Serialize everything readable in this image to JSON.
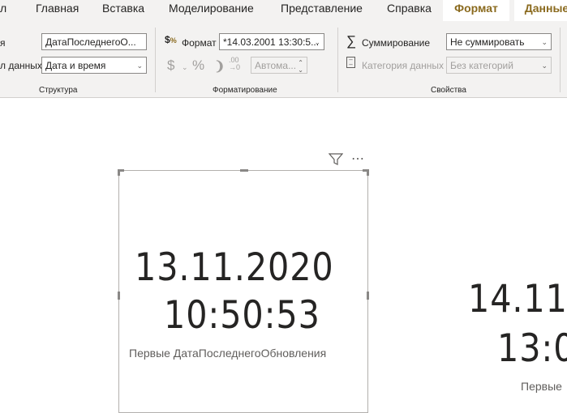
{
  "tabs": [
    {
      "label": "л"
    },
    {
      "label": "Главная"
    },
    {
      "label": "Вставка"
    },
    {
      "label": "Моделирование"
    },
    {
      "label": "Представление"
    },
    {
      "label": "Справка"
    },
    {
      "label": "Формат"
    },
    {
      "label": "Данные"
    }
  ],
  "structure": {
    "name_label": "я",
    "name_value": "ДатаПоследнегоО...",
    "type_label": "л данных",
    "type_value": "Дата и время",
    "group_label": "Структура"
  },
  "formatting": {
    "format_label": "Формат",
    "format_value": "*14.03.2001 13:30:5...",
    "currency_symbol": "$",
    "percent_symbol": "%",
    "comma_symbol": "❩",
    "decimal_value": "Автома...",
    "group_label": "Форматирование"
  },
  "properties": {
    "summarize_label": "Суммирование",
    "summarize_value": "Не суммировать",
    "category_label": "Категория данных",
    "category_value": "Без категорий",
    "group_label": "Свойства"
  },
  "card1": {
    "date": "13.11.2020",
    "time": "10:50:53",
    "caption": "Первые ДатаПоследнегоОбновления"
  },
  "card2": {
    "date": "14.11",
    "time": "13:0",
    "caption": "Первые"
  },
  "colors": {
    "active_tab": "#8a6a1e",
    "ribbon_bg": "#f3f2f1"
  }
}
